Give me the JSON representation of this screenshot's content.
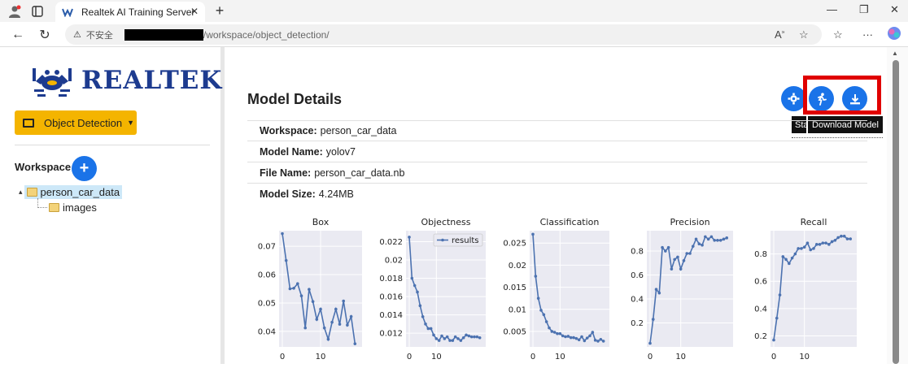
{
  "browser": {
    "tab_title": "Realtek AI Training Server",
    "tab_favicon_icon": "realtek-favicon-icon",
    "security_label": "不安全",
    "url_path": "/workspace/object_detection/"
  },
  "sidebar": {
    "logo_text": "REALTEK",
    "category_button": "Object Detection",
    "workspace_label": "Workspace",
    "tree": {
      "root": "person_car_data",
      "children": [
        "images"
      ]
    }
  },
  "main": {
    "title": "Model Details",
    "tooltip_fragment": "Sta",
    "tooltip": "Download Model",
    "info": [
      {
        "label": "Workspace:",
        "value": "person_car_data"
      },
      {
        "label": "Model Name:",
        "value": "yolov7"
      },
      {
        "label": "File Name:",
        "value": "person_car_data.nb"
      },
      {
        "label": "Model Size:",
        "value": "4.24MB"
      }
    ]
  },
  "colors": {
    "accent": "#1a73e8",
    "category_button": "#f4b400",
    "highlight_box": "#e00000",
    "chart_bg": "#eaeaf2",
    "chart_line": "#4c72b0"
  },
  "chart_data": [
    {
      "type": "line",
      "title": "Box",
      "x": [
        0,
        1,
        2,
        3,
        4,
        5,
        6,
        7,
        8,
        9,
        10,
        11,
        12,
        13,
        14,
        15,
        16,
        17,
        18,
        19
      ],
      "values": [
        0.0745,
        0.065,
        0.055,
        0.0552,
        0.0568,
        0.0525,
        0.0412,
        0.0548,
        0.0505,
        0.0442,
        0.0478,
        0.0412,
        0.0372,
        0.0432,
        0.0478,
        0.0425,
        0.0507,
        0.0422,
        0.0452,
        0.0356
      ],
      "xticks": [
        0,
        10
      ],
      "yticks": [
        0.04,
        0.05,
        0.06,
        0.07
      ],
      "ylim": [
        0.0345,
        0.0755
      ]
    },
    {
      "type": "line",
      "title": "Objectness",
      "legend": "results",
      "x": [
        0,
        1,
        2,
        3,
        4,
        5,
        6,
        7,
        8,
        9,
        10,
        11,
        12,
        13,
        14,
        15,
        16,
        17,
        18,
        19,
        20,
        21,
        22,
        23,
        24,
        25,
        26
      ],
      "values": [
        0.0225,
        0.018,
        0.0172,
        0.0165,
        0.015,
        0.0138,
        0.013,
        0.0125,
        0.0125,
        0.0118,
        0.0114,
        0.0112,
        0.0117,
        0.0114,
        0.0116,
        0.0112,
        0.0112,
        0.0116,
        0.0114,
        0.0112,
        0.0115,
        0.0118,
        0.0117,
        0.0116,
        0.0116,
        0.0116,
        0.0115
      ],
      "xticks": [
        0,
        10
      ],
      "yticks": [
        0.012,
        0.014,
        0.016,
        0.018,
        0.02,
        0.022
      ],
      "ylim": [
        0.0105,
        0.0232
      ]
    },
    {
      "type": "line",
      "title": "Classification",
      "x": [
        0,
        1,
        2,
        3,
        4,
        5,
        6,
        7,
        8,
        9,
        10,
        11,
        12,
        13,
        14,
        15,
        16,
        17,
        18,
        19,
        20,
        21,
        22,
        23,
        24,
        25,
        26
      ],
      "values": [
        0.027,
        0.0175,
        0.0125,
        0.0098,
        0.0088,
        0.0072,
        0.0058,
        0.005,
        0.0048,
        0.0045,
        0.0045,
        0.004,
        0.0038,
        0.0039,
        0.0036,
        0.0036,
        0.0034,
        0.0031,
        0.0038,
        0.0029,
        0.0035,
        0.004,
        0.0048,
        0.003,
        0.0028,
        0.0032,
        0.0028
      ],
      "xticks": [
        0,
        10
      ],
      "yticks": [
        0.005,
        0.01,
        0.015,
        0.02,
        0.025
      ],
      "ylim": [
        0.0015,
        0.0278
      ]
    },
    {
      "type": "line",
      "title": "Precision",
      "x": [
        0,
        1,
        2,
        3,
        4,
        5,
        6,
        7,
        8,
        9,
        10,
        11,
        12,
        13,
        14,
        15,
        16,
        17,
        18,
        19,
        20,
        21,
        22,
        23,
        24,
        25
      ],
      "values": [
        0.03,
        0.23,
        0.48,
        0.45,
        0.83,
        0.8,
        0.83,
        0.65,
        0.73,
        0.75,
        0.65,
        0.72,
        0.78,
        0.78,
        0.84,
        0.9,
        0.86,
        0.85,
        0.92,
        0.9,
        0.92,
        0.89,
        0.89,
        0.89,
        0.9,
        0.91
      ],
      "xticks": [
        0,
        10
      ],
      "yticks": [
        0.2,
        0.4,
        0.6,
        0.8
      ],
      "ylim": [
        0.0,
        0.97
      ]
    },
    {
      "type": "line",
      "title": "Recall",
      "x": [
        0,
        1,
        2,
        3,
        4,
        5,
        6,
        7,
        8,
        9,
        10,
        11,
        12,
        13,
        14,
        15,
        16,
        17,
        18,
        19,
        20,
        21,
        22,
        23,
        24,
        25
      ],
      "values": [
        0.17,
        0.33,
        0.5,
        0.78,
        0.76,
        0.73,
        0.77,
        0.8,
        0.84,
        0.84,
        0.85,
        0.88,
        0.83,
        0.84,
        0.87,
        0.87,
        0.88,
        0.88,
        0.87,
        0.89,
        0.9,
        0.92,
        0.93,
        0.93,
        0.91,
        0.91
      ],
      "xticks": [
        0,
        10
      ],
      "yticks": [
        0.2,
        0.4,
        0.6,
        0.8
      ],
      "ylim": [
        0.12,
        0.97
      ]
    }
  ]
}
